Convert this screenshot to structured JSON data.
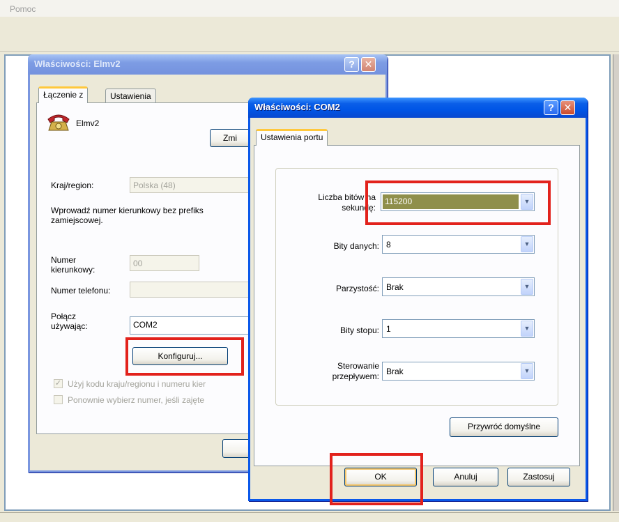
{
  "app": {
    "menu_help": "Pomoc"
  },
  "dialog_back": {
    "title": "Właściwości: Elmv2",
    "tabs": [
      "Łączenie z",
      "Ustawienia"
    ],
    "connection_name": "Elmv2",
    "change_icon_button": "Zmi",
    "country_label": "Kraj/region:",
    "country_value": "Polska (48)",
    "instruction": "Wprowadź numer kierunkowy bez prefiks",
    "instruction_line2": "zamiejscowej.",
    "area_code_label_1": "Numer",
    "area_code_label_2": "kierunkowy:",
    "area_code_value": "00",
    "phone_label": "Numer telefonu:",
    "connect_using_label_1": "Połącz",
    "connect_using_label_2": "używając:",
    "connect_using_value": "COM2",
    "configure_button": "Konfiguruj...",
    "use_country_code": "Użyj kodu kraju/regionu i numeru kier",
    "redial": "Ponownie wybierz numer, jeśli zajęte"
  },
  "dialog_front": {
    "title": "Właściwości: COM2",
    "tab": "Ustawienia portu",
    "bits_per_second_label_1": "Liczba bitów na",
    "bits_per_second_label_2": "sekundę:",
    "bits_per_second_value": "115200",
    "data_bits_label": "Bity danych:",
    "data_bits_value": "8",
    "parity_label": "Parzystość:",
    "parity_value": "Brak",
    "stop_bits_label": "Bity stopu:",
    "stop_bits_value": "1",
    "flow_control_label_1": "Sterowanie",
    "flow_control_label_2": "przepływem:",
    "flow_control_value": "Brak",
    "restore_defaults_button": "Przywróć domyślne",
    "ok_button": "OK",
    "cancel_button": "Anuluj",
    "apply_button": "Zastosuj"
  },
  "titlebar_buttons": {
    "help": "?",
    "close": "✕"
  },
  "colors": {
    "highlight": "#e2221c",
    "title_active": "#0a5ee8",
    "selection": "#8f8f4b"
  }
}
